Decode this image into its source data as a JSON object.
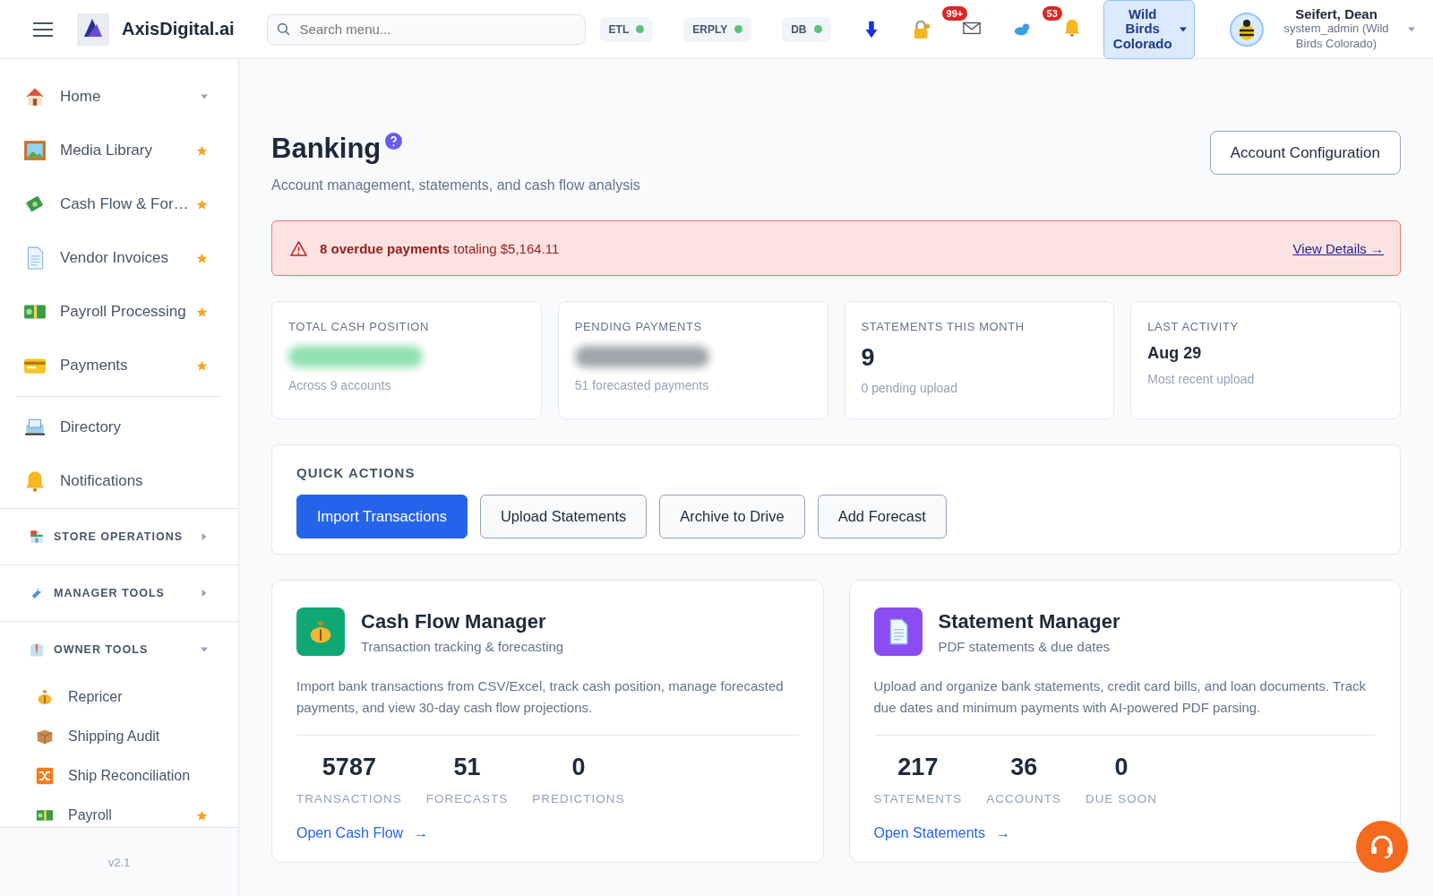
{
  "header": {
    "brand": "AxisDigital.ai",
    "search": {
      "placeholder": "Search menu..."
    },
    "services": [
      {
        "label": "ETL",
        "color": "#5cc27a"
      },
      {
        "label": "ERPLY",
        "color": "#5cc27a"
      },
      {
        "label": "DB",
        "color": "#5cc27a"
      }
    ],
    "mail_badge": "99+",
    "bell_badge": "53",
    "store_select": {
      "value": "Wild Birds Colorado"
    },
    "user": {
      "name": "Seifert, Dean",
      "role": "system_admin (Wild Birds Colorado)"
    }
  },
  "sidebar": {
    "items": [
      {
        "label": "Home",
        "kind": "caret",
        "expanded": true
      },
      {
        "label": "Media Library",
        "kind": "star",
        "starred": true
      },
      {
        "label": "Cash Flow & For…",
        "kind": "star",
        "starred": true
      },
      {
        "label": "Vendor Invoices",
        "kind": "star",
        "starred": true
      },
      {
        "label": "Payroll Processing",
        "kind": "star",
        "starred": true
      },
      {
        "label": "Payments",
        "kind": "star",
        "starred": true
      },
      {
        "label": "Directory",
        "kind": "divided",
        "starred": false
      },
      {
        "label": "Notifications",
        "kind": "plain",
        "starred": false
      }
    ],
    "sections": [
      {
        "label": "STORE OPERATIONS",
        "expanded": false
      },
      {
        "label": "MANAGER TOOLS",
        "expanded": false
      },
      {
        "label": "OWNER TOOLS",
        "expanded": true,
        "children": [
          {
            "label": "Repricer",
            "starred": false
          },
          {
            "label": "Shipping Audit",
            "starred": false
          },
          {
            "label": "Ship Reconciliation",
            "starred": false
          },
          {
            "label": "Payroll",
            "starred": true
          }
        ]
      }
    ],
    "version": "v2.1"
  },
  "page": {
    "title": "Banking",
    "subtitle": "Account management, statements, and cash flow analysis",
    "config_button": "Account Configuration",
    "alert": {
      "text": "**8 overdue payments** totaling $5,164.11",
      "link": "View Details →"
    },
    "stats": [
      {
        "label": "TOTAL CASH POSITION",
        "kind": "blurred",
        "color": "#8fe0b0",
        "note": "Across 9 accounts"
      },
      {
        "label": "PENDING PAYMENTS",
        "kind": "blurred",
        "color": "#a0a4ab",
        "note": "51 forecasted payments"
      },
      {
        "label": "STATEMENTS THIS MONTH",
        "kind": "number",
        "value": "9",
        "note": "0 pending upload"
      },
      {
        "label": "LAST ACTIVITY",
        "kind": "text",
        "value": "Aug 29",
        "note": "Most recent upload"
      }
    ],
    "quick_actions": {
      "title": "QUICK ACTIONS",
      "buttons": [
        {
          "label": "Import Transactions",
          "primary": true
        },
        {
          "label": "Upload Statements",
          "primary": false
        },
        {
          "label": "Archive to Drive",
          "primary": false
        },
        {
          "label": "Add Forecast",
          "primary": false
        }
      ]
    },
    "modules": [
      {
        "title": "Cash Flow Manager",
        "subtitle": "Transaction tracking & forecasting",
        "color": "#10a872",
        "description": "Import bank transactions from CSV/Excel, track cash position, manage forecasted payments, and view 30-day cash flow projections.",
        "metrics": [
          {
            "value": "5787",
            "label": "TRANSACTIONS"
          },
          {
            "value": "51",
            "label": "FORECASTS"
          },
          {
            "value": "0",
            "label": "PREDICTIONS"
          }
        ],
        "link": "Open Cash Flow",
        "arrow": "→"
      },
      {
        "title": "Statement Manager",
        "subtitle": "PDF statements & due dates",
        "color": "#8b4cf0",
        "description": "Upload and organize bank statements, credit card bills, and loan documents. Track due dates and minimum payments with AI-powered PDF parsing.",
        "metrics": [
          {
            "value": "217",
            "label": "STATEMENTS"
          },
          {
            "value": "36",
            "label": "ACCOUNTS"
          },
          {
            "value": "0",
            "label": "DUE SOON"
          }
        ],
        "link": "Open Statements",
        "arrow": "→"
      }
    ]
  }
}
